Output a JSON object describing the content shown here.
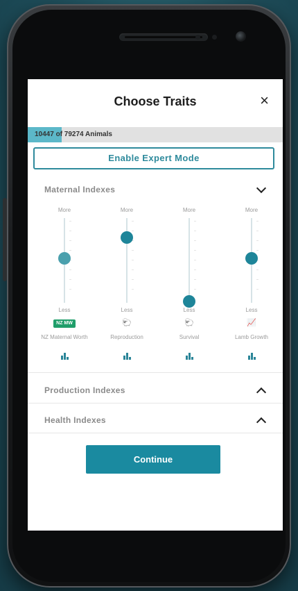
{
  "screen": {
    "title": "Choose Traits",
    "close_icon": "×"
  },
  "progress": {
    "count_text": "10447 of 79274 Animals",
    "fraction": 0.132
  },
  "expert_mode": {
    "label": "Enable Expert Mode"
  },
  "sections": {
    "maternal": {
      "label": "Maternal Indexes",
      "state": "expanded"
    },
    "production": {
      "label": "Production Indexes",
      "state": "collapsed"
    },
    "health": {
      "label": "Health Indexes",
      "state": "collapsed"
    }
  },
  "traits": [
    {
      "more": "More",
      "less": "Less",
      "name": "NZ Maternal Worth",
      "icon": "nz-badge",
      "badge_text": "NZ MW",
      "level": 0.55
    },
    {
      "more": "More",
      "less": "Less",
      "name": "Reproduction",
      "icon": "ewe-lamb-icon",
      "icon_glyph": "🐑",
      "level": 0.82
    },
    {
      "more": "More",
      "less": "Less",
      "name": "Survival",
      "icon": "sheep-pair-icon",
      "icon_glyph": "🐑",
      "level": 0.0
    },
    {
      "more": "More",
      "less": "Less",
      "name": "Lamb Growth",
      "icon": "growth-chart-icon",
      "icon_glyph": "📈",
      "level": 0.55
    }
  ],
  "continue_button": {
    "label": "Continue"
  },
  "colors": {
    "accent": "#1a8aa0",
    "progress_fill": "#5cb8c9",
    "badge_green": "#1f9e6a"
  }
}
